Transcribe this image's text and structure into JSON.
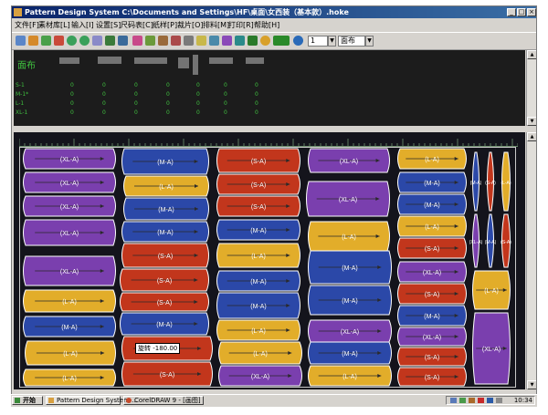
{
  "window": {
    "title": "Pattern Design System   C:\\Documents and Settings\\HF\\桌面\\女西装（基本款）.hoke"
  },
  "menu": [
    "文件[F]",
    "素材库[L]",
    "输入[I]",
    "设置[S]",
    "尺码表[C]",
    "纸样[P]",
    "裁片[O]",
    "排料[M]",
    "打印[R]",
    "帮助[H]"
  ],
  "toolbar": {
    "number_value": "1",
    "mode_value": "面布"
  },
  "info_panel": {
    "title": "面布",
    "rows": [
      {
        "label": "S-1",
        "values": [
          "0",
          "0",
          "0",
          "0",
          "0",
          "0",
          "0"
        ]
      },
      {
        "label": "M-1*",
        "values": [
          "0",
          "0",
          "0",
          "0",
          "0",
          "0",
          "0"
        ]
      },
      {
        "label": "L-1",
        "values": [
          "0",
          "0",
          "0",
          "0",
          "0",
          "0",
          "0"
        ]
      },
      {
        "label": "XL-1",
        "values": [
          "0",
          "0",
          "0",
          "0",
          "0",
          "0",
          "0"
        ]
      }
    ]
  },
  "marker": {
    "tooltip": "旋转 -180.00",
    "colors": {
      "XL": "#7a3fae",
      "L": "#e2ad2a",
      "S": "#c2361c",
      "M": "#2b48a8",
      "outline": "#ffffff",
      "arrow": "#2a2a2a"
    },
    "pieces": [
      {
        "size": "XL",
        "label": "(XL-A)"
      },
      {
        "size": "XL",
        "label": "(XL-A)"
      },
      {
        "size": "XL",
        "label": "(XL-A)"
      },
      {
        "size": "XL",
        "label": "(XL-A)"
      },
      {
        "size": "XL",
        "label": "(XL-A)"
      },
      {
        "size": "L",
        "label": "(L-A)"
      },
      {
        "size": "M",
        "label": "(M-A)"
      },
      {
        "size": "L",
        "label": "(L-A)"
      },
      {
        "size": "L",
        "label": "(L-A)"
      },
      {
        "size": "M",
        "label": "(M-A)"
      },
      {
        "size": "L",
        "label": "(L-A)"
      },
      {
        "size": "M",
        "label": "(M-A)"
      },
      {
        "size": "M",
        "label": "(M-A)"
      },
      {
        "size": "S",
        "label": "(S-A)"
      },
      {
        "size": "S",
        "label": "(S-A)"
      },
      {
        "size": "S",
        "label": "(S-A)"
      },
      {
        "size": "M",
        "label": "(M-A)"
      },
      {
        "size": "S",
        "label": "(S-A)"
      },
      {
        "size": "S",
        "label": "(S-A)"
      },
      {
        "size": "S",
        "label": "(S-A)"
      },
      {
        "size": "S",
        "label": "(S-A)"
      },
      {
        "size": "S",
        "label": "(S-A)"
      },
      {
        "size": "M",
        "label": "(M-A)"
      },
      {
        "size": "L",
        "label": "(L-A)"
      },
      {
        "size": "M",
        "label": "(M-A)"
      },
      {
        "size": "M",
        "label": "(M-A)"
      },
      {
        "size": "L",
        "label": "(L-A)"
      },
      {
        "size": "L",
        "label": "(L-A)"
      },
      {
        "size": "XL",
        "label": "(XL-A)"
      },
      {
        "size": "XL",
        "label": "(XL-A)"
      },
      {
        "size": "XL",
        "label": "(XL-A)"
      },
      {
        "size": "L",
        "label": "(L-A)"
      },
      {
        "size": "M",
        "label": "(M-A)"
      },
      {
        "size": "M",
        "label": "(M-A)"
      },
      {
        "size": "XL",
        "label": "(XL-A)"
      },
      {
        "size": "M",
        "label": "(M-A)"
      },
      {
        "size": "L",
        "label": "(L-A)"
      },
      {
        "size": "L",
        "label": "(L-A)"
      },
      {
        "size": "M",
        "label": "(M-A)"
      },
      {
        "size": "M",
        "label": "(M-A)"
      },
      {
        "size": "L",
        "label": "(L-A)"
      },
      {
        "size": "S",
        "label": "(S-A)"
      },
      {
        "size": "XL",
        "label": "(XL-A)"
      },
      {
        "size": "S",
        "label": "(S-A)"
      },
      {
        "size": "M",
        "label": "(M-A)"
      },
      {
        "size": "XL",
        "label": "(XL-A)"
      },
      {
        "size": "S",
        "label": "(S-A)"
      },
      {
        "size": "S",
        "label": "(S-A)"
      },
      {
        "size": "M",
        "label": "(M-A)"
      },
      {
        "size": "S",
        "label": "(S-A)"
      },
      {
        "size": "L",
        "label": "(L-A)"
      },
      {
        "size": "XL",
        "label": "(XL-A)"
      },
      {
        "size": "M",
        "label": "(M-A)"
      },
      {
        "size": "S",
        "label": "(S-A)"
      },
      {
        "size": "XL",
        "label": "(XL-A)"
      },
      {
        "size": "L",
        "label": "(L-A)"
      }
    ]
  },
  "taskbar": {
    "start": "开始",
    "items": [
      "Pattern Design System ...",
      "CorelDRAW 9 - [画图]"
    ],
    "clock": "10:34"
  }
}
